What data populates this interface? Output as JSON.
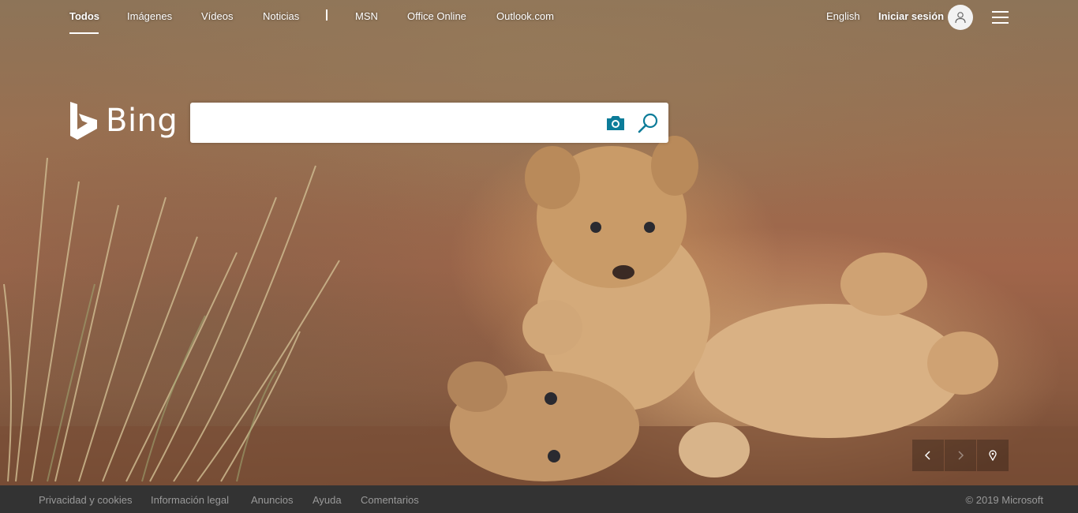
{
  "nav": {
    "items": [
      {
        "label": "Todos",
        "active": true
      },
      {
        "label": "Imágenes"
      },
      {
        "label": "Vídeos"
      },
      {
        "label": "Noticias"
      },
      {
        "label": "MSN"
      },
      {
        "label": "Office Online"
      },
      {
        "label": "Outlook.com"
      }
    ],
    "separator": "|"
  },
  "account": {
    "language": "English",
    "signin": "Iniciar sesión",
    "avatar_icon": "user-icon",
    "menu_icon": "hamburger-menu-icon"
  },
  "logo": {
    "text": "Bing",
    "icon": "bing-b-icon"
  },
  "search": {
    "value": "",
    "placeholder": "",
    "camera_icon": "camera-icon",
    "search_icon": "magnifier-icon",
    "accent_color": "#0c7c99"
  },
  "carousel": {
    "prev_icon": "chevron-left-icon",
    "next_icon": "chevron-right-icon",
    "location_icon": "location-pin-icon"
  },
  "footer": {
    "links": [
      "Privacidad y cookies",
      "Información legal",
      "Anuncios",
      "Ayuda",
      "Comentarios"
    ],
    "copyright": "© 2019 Microsoft"
  }
}
